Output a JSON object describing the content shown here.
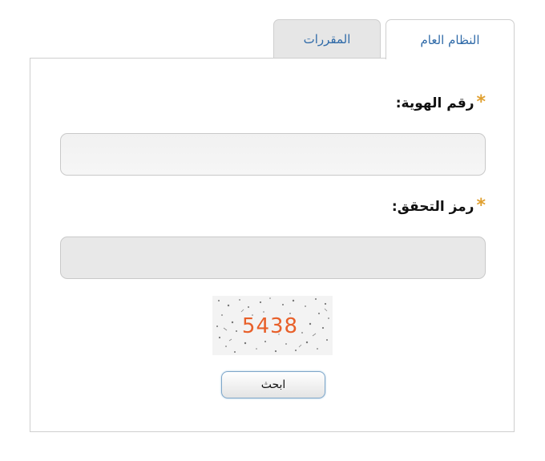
{
  "tabs": {
    "general": "النظام العام",
    "courses": "المقررات"
  },
  "form": {
    "required_mark": "*",
    "id_label": "رقم الهوية:",
    "id_value": "",
    "code_label": "رمز التحقق:",
    "code_value": "",
    "captcha_text": "5438",
    "search_label": "ابحث"
  },
  "colors": {
    "tab_text": "#2f6aa8",
    "required_star": "#e0a030",
    "captcha_digits": "#e8602a"
  }
}
